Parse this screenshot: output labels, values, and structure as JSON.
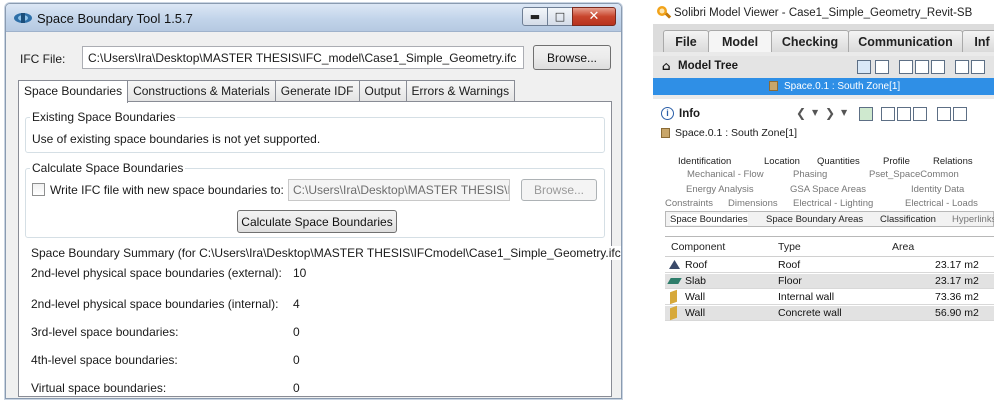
{
  "space_boundary_tool": {
    "title": "Space Boundary Tool 1.5.7",
    "ifc_file_label": "IFC File:",
    "ifc_file_path": "C:\\Users\\Ira\\Desktop\\MASTER THESIS\\IFC_model\\Case1_Simple_Geometry.ifc",
    "browse_label": "Browse...",
    "tabs": [
      "Space Boundaries",
      "Constructions & Materials",
      "Generate IDF",
      "Output",
      "Errors & Warnings"
    ],
    "existing": {
      "title": "Existing Space Boundaries",
      "text": "Use of existing space boundaries is not yet supported."
    },
    "calculate": {
      "title": "Calculate Space Boundaries",
      "checkbox_label": "Write IFC file with new space boundaries to:",
      "path": "C:\\Users\\Ira\\Desktop\\MASTER THESIS\\IFC",
      "browse_label": "Browse...",
      "button_label": "Calculate Space Boundaries"
    },
    "summary": {
      "title": "Space Boundary Summary (for C:\\Users\\Ira\\Desktop\\MASTER THESIS\\IFCmodel\\Case1_Simple_Geometry.ifc)",
      "rows": [
        {
          "label": "2nd-level physical space boundaries (external):",
          "value": "10"
        },
        {
          "label": "2nd-level physical space boundaries (internal):",
          "value": "4"
        },
        {
          "label": "3rd-level space boundaries:",
          "value": "0"
        },
        {
          "label": "4th-level space boundaries:",
          "value": "0"
        },
        {
          "label": "Virtual space boundaries:",
          "value": "0"
        }
      ]
    }
  },
  "solibri": {
    "title": "Solibri Model Viewer - Case1_Simple_Geometry_Revit-SB",
    "ribbon_tabs": [
      "File",
      "Model",
      "Checking",
      "Communication",
      "Inf"
    ],
    "model_tree_label": "Model Tree",
    "model_tree_selected": "Space.0.1 : South Zone[1]",
    "info_label": "Info",
    "info_object": "Space.0.1 : South Zone[1]",
    "property_tabs": {
      "row1": [
        "Identification",
        "Location",
        "Quantities",
        "Profile",
        "Relations"
      ],
      "row2": [
        "Mechanical - Flow",
        "Phasing",
        "Pset_SpaceCommon"
      ],
      "row3": [
        "Energy Analysis",
        "GSA Space Areas",
        "Identity Data"
      ],
      "row4": [
        "Constraints",
        "Dimensions",
        "Electrical - Lighting",
        "Electrical - Loads"
      ],
      "row5": [
        "Space Boundaries",
        "Space Boundary Areas",
        "Classification",
        "Hyperlinks"
      ]
    },
    "table": {
      "headers": [
        "Component",
        "Type",
        "Area"
      ],
      "rows": [
        {
          "component": "Roof",
          "type": "Roof",
          "area": "23.17 m2"
        },
        {
          "component": "Slab",
          "type": "Floor",
          "area": "23.17 m2"
        },
        {
          "component": "Wall",
          "type": "Internal wall",
          "area": "73.36 m2"
        },
        {
          "component": "Wall",
          "type": "Concrete wall",
          "area": "56.90 m2"
        }
      ]
    },
    "icon_colors": {
      "roof": "#3a4a6a",
      "slab": "#2e7d6a",
      "wall": "#d7a93a"
    }
  }
}
